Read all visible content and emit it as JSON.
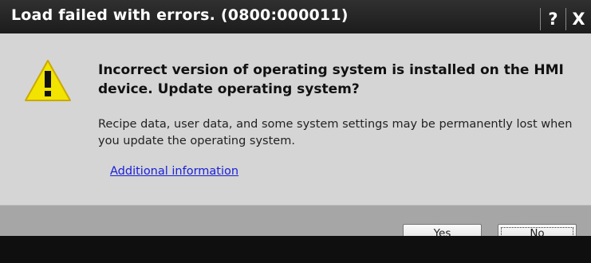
{
  "dialog": {
    "title": "Load failed with errors. (0800:000011)",
    "help_label": "?",
    "close_label": "X",
    "headline": "Incorrect version of operating system is installed on the HMI device. Update operating system?",
    "description": "Recipe data, user data, and some system settings may be permanently lost when you update the operating system.",
    "link_label": "Additional information",
    "icon": "warning-icon"
  },
  "buttons": {
    "yes_label": "Yes",
    "no_label": "No"
  },
  "colors": {
    "titlebar": "#1c1c1c",
    "body": "#d5d5d5",
    "footer": "#a6a6a6",
    "link": "#1a21d6",
    "warning_yellow": "#f2e300"
  }
}
